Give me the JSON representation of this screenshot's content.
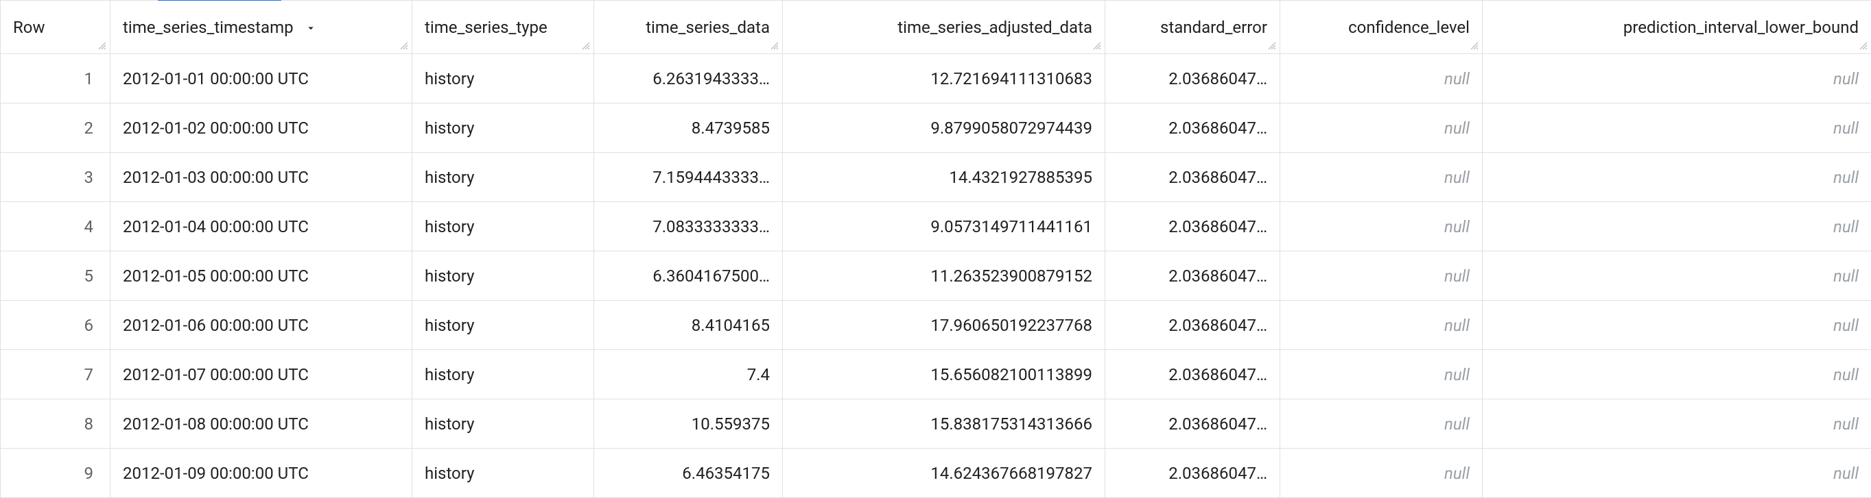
{
  "table": {
    "columns": [
      {
        "key": "row",
        "label": "Row",
        "sortable": true,
        "sorted": false
      },
      {
        "key": "ts",
        "label": "time_series_timestamp",
        "sortable": true,
        "sorted": true,
        "sort_dir": "desc"
      },
      {
        "key": "type",
        "label": "time_series_type",
        "sortable": true,
        "sorted": false
      },
      {
        "key": "data",
        "label": "time_series_data",
        "sortable": true,
        "sorted": false
      },
      {
        "key": "adj",
        "label": "time_series_adjusted_data",
        "sortable": true,
        "sorted": false
      },
      {
        "key": "err",
        "label": "standard_error",
        "sortable": true,
        "sorted": false
      },
      {
        "key": "conf",
        "label": "confidence_level",
        "sortable": true,
        "sorted": false
      },
      {
        "key": "pilb",
        "label": "prediction_interval_lower_bound",
        "sortable": true,
        "sorted": false
      }
    ],
    "rows": [
      {
        "row": "1",
        "ts": "2012-01-01 00:00:00 UTC",
        "type": "history",
        "data": "6.2631943333…",
        "adj": "12.721694111310683",
        "err": "2.03686047…",
        "conf": null,
        "pilb": null
      },
      {
        "row": "2",
        "ts": "2012-01-02 00:00:00 UTC",
        "type": "history",
        "data": "8.4739585",
        "adj": "9.8799058072974439",
        "err": "2.03686047…",
        "conf": null,
        "pilb": null
      },
      {
        "row": "3",
        "ts": "2012-01-03 00:00:00 UTC",
        "type": "history",
        "data": "7.1594443333…",
        "adj": "14.4321927885395",
        "err": "2.03686047…",
        "conf": null,
        "pilb": null
      },
      {
        "row": "4",
        "ts": "2012-01-04 00:00:00 UTC",
        "type": "history",
        "data": "7.0833333333…",
        "adj": "9.0573149711441161",
        "err": "2.03686047…",
        "conf": null,
        "pilb": null
      },
      {
        "row": "5",
        "ts": "2012-01-05 00:00:00 UTC",
        "type": "history",
        "data": "6.3604167500…",
        "adj": "11.263523900879152",
        "err": "2.03686047…",
        "conf": null,
        "pilb": null
      },
      {
        "row": "6",
        "ts": "2012-01-06 00:00:00 UTC",
        "type": "history",
        "data": "8.4104165",
        "adj": "17.960650192237768",
        "err": "2.03686047…",
        "conf": null,
        "pilb": null
      },
      {
        "row": "7",
        "ts": "2012-01-07 00:00:00 UTC",
        "type": "history",
        "data": "7.4",
        "adj": "15.656082100113899",
        "err": "2.03686047…",
        "conf": null,
        "pilb": null
      },
      {
        "row": "8",
        "ts": "2012-01-08 00:00:00 UTC",
        "type": "history",
        "data": "10.559375",
        "adj": "15.838175314313666",
        "err": "2.03686047…",
        "conf": null,
        "pilb": null
      },
      {
        "row": "9",
        "ts": "2012-01-09 00:00:00 UTC",
        "type": "history",
        "data": "6.46354175",
        "adj": "14.624367668197827",
        "err": "2.03686047…",
        "conf": null,
        "pilb": null
      }
    ],
    "null_text": "null"
  },
  "colors": {
    "accent": "#1a73e8",
    "border": "#e0e0e0",
    "text": "#202124",
    "muted": "#5f6368",
    "null": "#9aa0a6"
  }
}
